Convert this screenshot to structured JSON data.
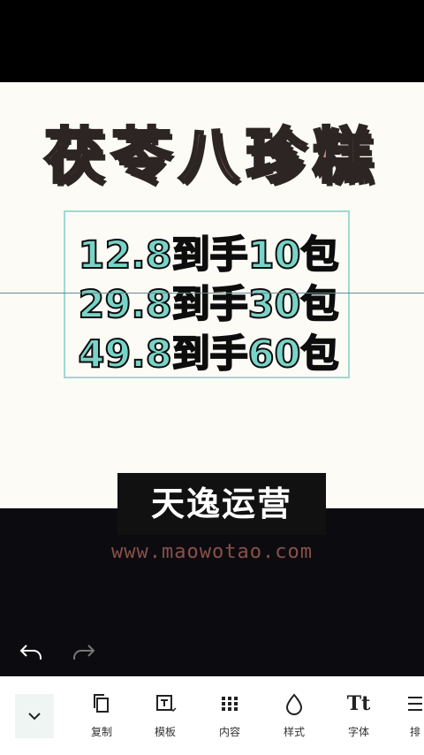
{
  "canvas": {
    "title": "茯苓八珍糕",
    "prices": [
      "12.8到手10包",
      "29.8到手30包",
      "49.8到手60包"
    ]
  },
  "overlay": {
    "subtitle": "天逸运营",
    "watermark": "www.maowotao.com"
  },
  "toolbar": {
    "items": [
      {
        "label": "复制",
        "icon": "copy-icon"
      },
      {
        "label": "模板",
        "icon": "template-icon"
      },
      {
        "label": "内容",
        "icon": "grid-icon"
      },
      {
        "label": "样式",
        "icon": "drop-icon"
      },
      {
        "label": "字体",
        "icon": "font-icon",
        "glyph": "Tt"
      },
      {
        "label": "排",
        "icon": "arrange-icon"
      }
    ]
  },
  "colors": {
    "title_fill": "#b88479",
    "price_fill": "#78d4c8",
    "selection_border": "#9fd8d2",
    "watermark": "#8a5049"
  }
}
